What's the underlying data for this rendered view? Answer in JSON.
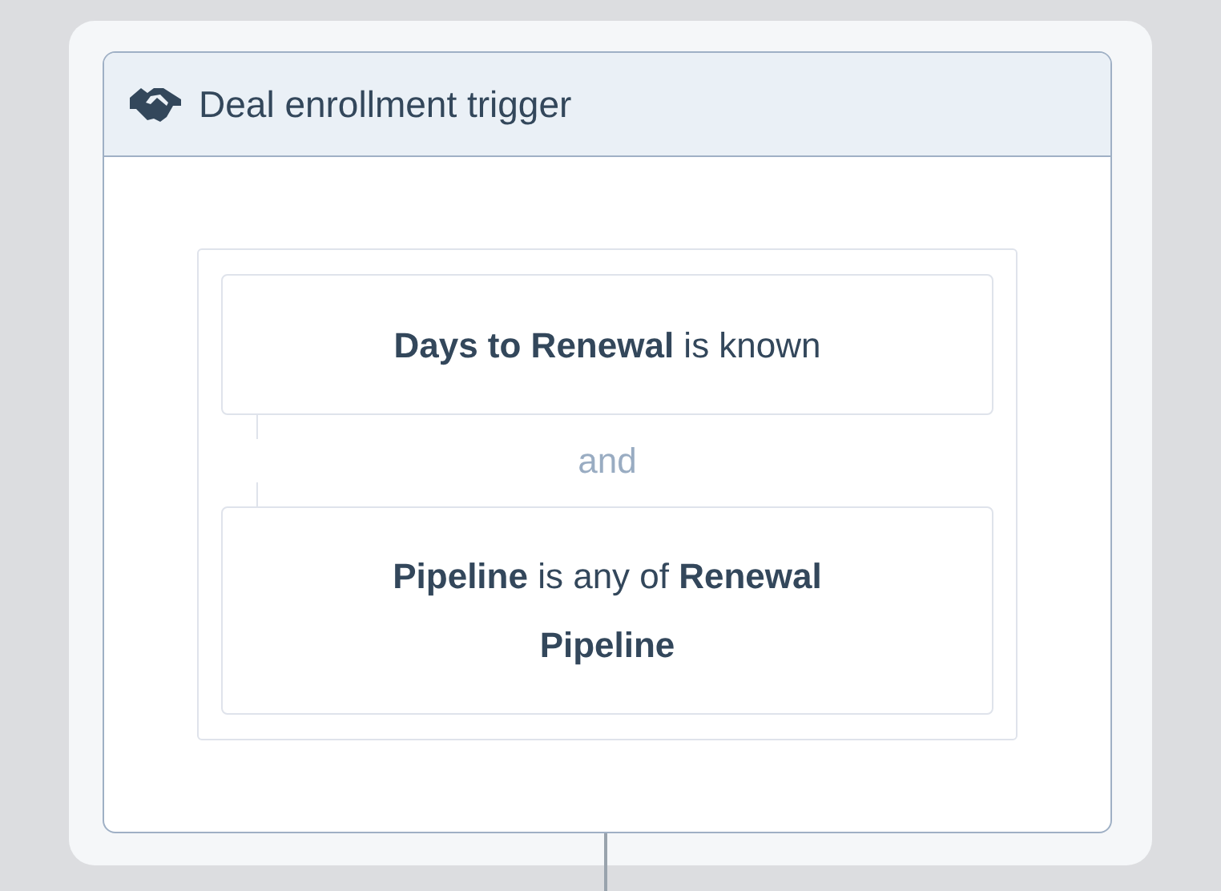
{
  "card": {
    "title": "Deal enrollment trigger"
  },
  "conditions": [
    {
      "text": "**Days to Renewal** is known"
    },
    {
      "text": "**Pipeline** is any of **Renewal Pipeline**"
    }
  ],
  "conjunctions": [
    "and"
  ]
}
